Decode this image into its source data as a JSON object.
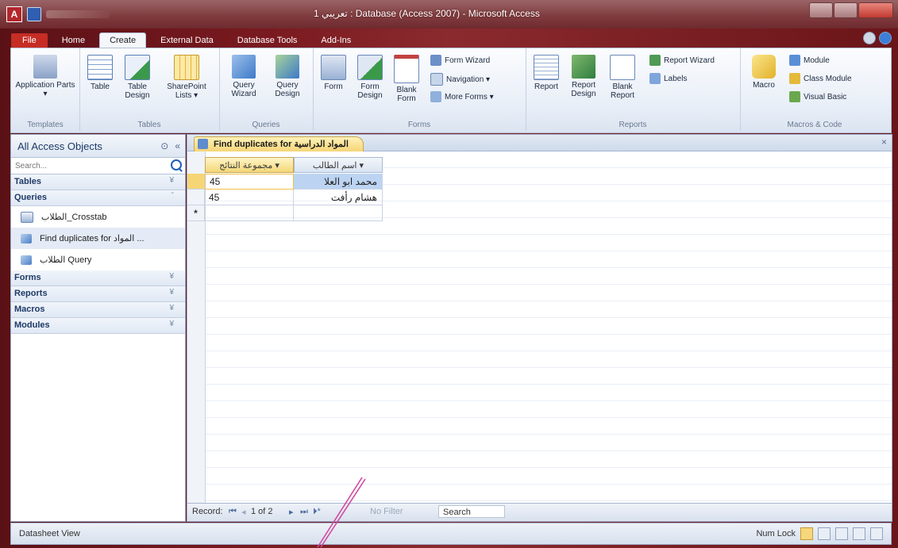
{
  "window": {
    "title": "تعريبي 1 : Database (Access 2007) - Microsoft Access"
  },
  "ribbon_tabs": [
    "File",
    "Home",
    "Create",
    "External Data",
    "Database Tools",
    "Add-Ins"
  ],
  "ribbon": {
    "groups": {
      "templates": "Templates",
      "tables": "Tables",
      "queries": "Queries",
      "forms": "Forms",
      "reports": "Reports",
      "macros": "Macros & Code"
    },
    "buttons": {
      "application_parts": "Application Parts ▾",
      "table": "Table",
      "table_design": "Table Design",
      "sharepoint_lists": "SharePoint Lists ▾",
      "query_wizard": "Query Wizard",
      "query_design": "Query Design",
      "form": "Form",
      "form_design": "Form Design",
      "blank_form": "Blank Form",
      "form_wizard": "Form Wizard",
      "navigation": "Navigation ▾",
      "more_forms": "More Forms ▾",
      "report": "Report",
      "report_design": "Report Design",
      "blank_report": "Blank Report",
      "report_wizard": "Report Wizard",
      "labels": "Labels",
      "macro": "Macro",
      "module": "Module",
      "class_module": "Class Module",
      "visual_basic": "Visual Basic"
    }
  },
  "nav_pane": {
    "title": "All Access Objects",
    "search_placeholder": "Search...",
    "groups": {
      "tables": "Tables",
      "queries": "Queries",
      "forms": "Forms",
      "reports": "Reports",
      "macros": "Macros",
      "modules": "Modules"
    },
    "query_items": [
      "الطلاب_Crosstab",
      "Find duplicates for المواد ...",
      "الطلاب Query"
    ]
  },
  "document": {
    "tab_title": "Find duplicates for المواد الدراسية",
    "columns": [
      "مجموعة النتائج",
      "اسم الطالب"
    ],
    "rows": [
      {
        "score": "45",
        "name": "محمد ابو العلا"
      },
      {
        "score": "45",
        "name": "هشام رأفت"
      }
    ],
    "new_row_marker": "*",
    "record_nav": {
      "label": "Record:",
      "position": "1 of 2",
      "filter": "No Filter",
      "search": "Search"
    }
  },
  "status_bar": {
    "left": "Datasheet View",
    "right": "Num Lock"
  },
  "colors": {
    "frame": "#7a1a20",
    "file_tab": "#c62d24",
    "header_gold": "#f3d778"
  }
}
